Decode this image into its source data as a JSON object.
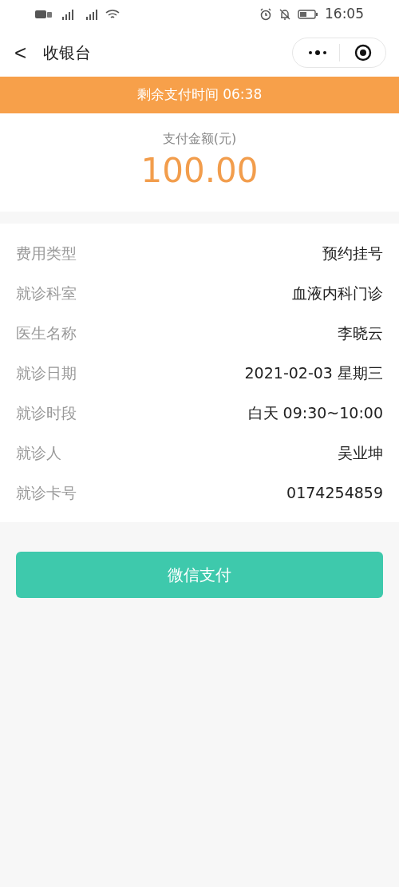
{
  "status_bar": {
    "time": "16:05"
  },
  "header": {
    "back": "<",
    "title": "收银台"
  },
  "countdown": {
    "text": "剩余支付时间 06:38"
  },
  "amount": {
    "label": "支付金额(元)",
    "value": "100.00"
  },
  "details": [
    {
      "label": "费用类型",
      "value": "预约挂号"
    },
    {
      "label": "就诊科室",
      "value": "血液内科门诊"
    },
    {
      "label": "医生名称",
      "value": "李晓云"
    },
    {
      "label": "就诊日期",
      "value": "2021-02-03 星期三"
    },
    {
      "label": "就诊时段",
      "value": "白天 09:30~10:00"
    },
    {
      "label": "就诊人",
      "value": "吴业坤"
    },
    {
      "label": "就诊卡号",
      "value": "0174254859"
    }
  ],
  "pay_button": "微信支付"
}
